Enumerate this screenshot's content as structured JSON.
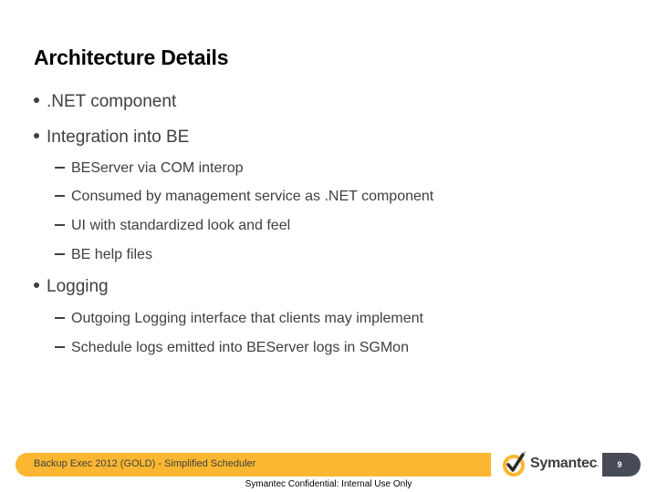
{
  "slide": {
    "title": "Architecture Details",
    "bullets": [
      {
        "text": ".NET component",
        "sub": []
      },
      {
        "text": "Integration into BE",
        "sub": [
          "BEServer via COM interop",
          "Consumed by management service as .NET component",
          "UI with standardized look and feel",
          "BE help files"
        ]
      },
      {
        "text": "Logging",
        "sub": [
          "Outgoing Logging interface that clients may implement",
          "Schedule logs emitted into BEServer logs in SGMon"
        ]
      }
    ]
  },
  "footer": {
    "banner_text": "Backup Exec 2012 (GOLD) - Simplified Scheduler",
    "logo_text": "Symantec",
    "logo_dot": ".",
    "page_number": "9",
    "confidential": "Symantec Confidential:  Internal Use Only"
  },
  "colors": {
    "banner": "#fbb731",
    "page_tab": "#474b55",
    "logo_yellow": "#fbb731",
    "body_text": "#404040"
  }
}
